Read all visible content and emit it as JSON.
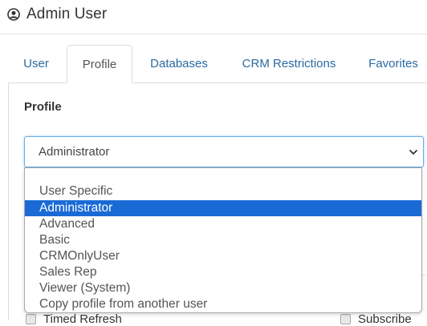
{
  "header": {
    "title": "Admin User",
    "icon": "user-circle-icon"
  },
  "tabs": [
    {
      "label": "User",
      "active": false
    },
    {
      "label": "Profile",
      "active": true
    },
    {
      "label": "Databases",
      "active": false
    },
    {
      "label": "CRM Restrictions",
      "active": false
    },
    {
      "label": "Favorites",
      "active": false
    }
  ],
  "profile_section": {
    "label": "Profile",
    "select": {
      "value": "Administrator",
      "options": [
        "User Specific",
        "Administrator",
        "Advanced",
        "Basic",
        "CRMOnlyUser",
        "Sales Rep",
        "Viewer (System)",
        "Copy profile from another user"
      ],
      "selected_index": 1
    }
  },
  "background_rows": {
    "timed_refresh_label": "Timed Refresh",
    "subscribe_label": "Subscribe",
    "partial_right_text": "s"
  },
  "colors": {
    "accent": "#1a6ad6",
    "link": "#2a6aa0",
    "focus_border": "#66afe9"
  }
}
